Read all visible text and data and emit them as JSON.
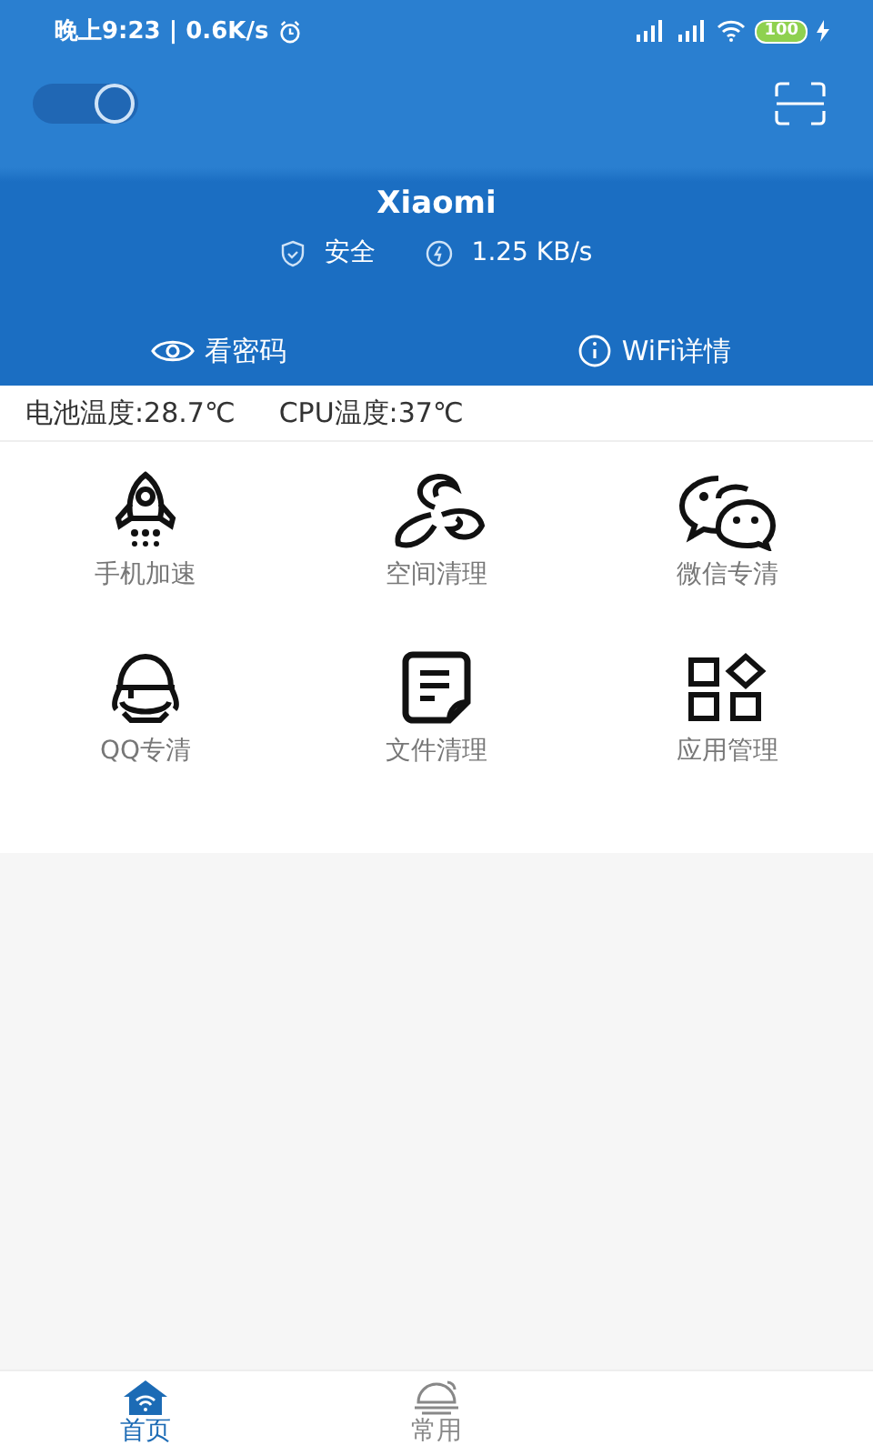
{
  "status_bar": {
    "time": "晚上9:23 | 0.6K/s",
    "battery": "100"
  },
  "header": {
    "toggle": {
      "on": true
    },
    "network_name": "Xiaomi",
    "security": "安全",
    "speed": "1.25 KB/s",
    "actions": [
      {
        "kind": "eye",
        "label": "看密码"
      },
      {
        "kind": "info",
        "label": "WiFi详情"
      }
    ]
  },
  "temperatures": [
    "电池温度:28.7℃",
    "CPU温度:37℃"
  ],
  "tools": [
    {
      "kind": "rocket",
      "label": "手机加速"
    },
    {
      "kind": "fan",
      "label": "空间清理"
    },
    {
      "kind": "chat",
      "label": "微信专清"
    },
    {
      "kind": "penguin",
      "label": "QQ专清"
    },
    {
      "kind": "note",
      "label": "文件清理"
    },
    {
      "kind": "apps",
      "label": "应用管理"
    }
  ],
  "bottom_nav": [
    {
      "kind": "home",
      "label": "首页",
      "selected": true
    },
    {
      "kind": "bell",
      "label": "常用",
      "selected": false
    }
  ]
}
